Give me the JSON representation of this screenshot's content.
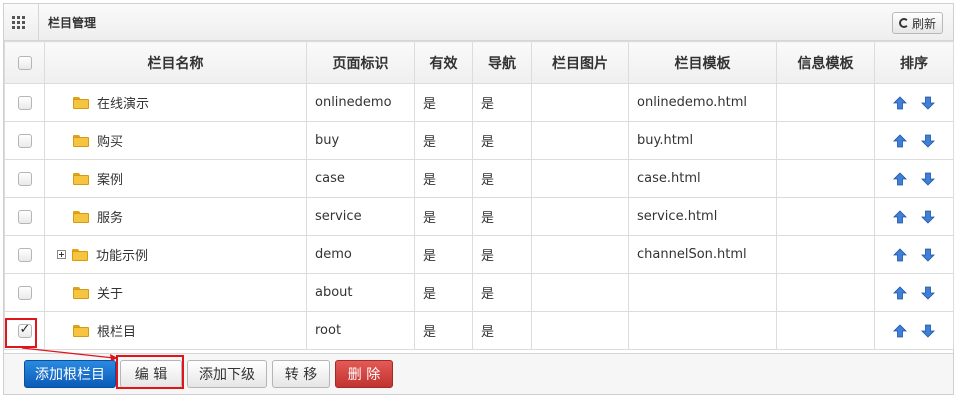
{
  "panel": {
    "title": "栏目管理",
    "refresh_label": "刷新",
    "icon": "grid-icon"
  },
  "table": {
    "columns": [
      "栏目名称",
      "页面标识",
      "有效",
      "导航",
      "栏目图片",
      "栏目模板",
      "信息模板",
      "排序"
    ],
    "rows": [
      {
        "name": "在线演示",
        "page_id": "onlinedemo",
        "valid": "是",
        "nav": "是",
        "image": "",
        "template": "onlinedemo.html",
        "info_template": "",
        "checked": false,
        "expandable": false
      },
      {
        "name": "购买",
        "page_id": "buy",
        "valid": "是",
        "nav": "是",
        "image": "",
        "template": "buy.html",
        "info_template": "",
        "checked": false,
        "expandable": false
      },
      {
        "name": "案例",
        "page_id": "case",
        "valid": "是",
        "nav": "是",
        "image": "",
        "template": "case.html",
        "info_template": "",
        "checked": false,
        "expandable": false
      },
      {
        "name": "服务",
        "page_id": "service",
        "valid": "是",
        "nav": "是",
        "image": "",
        "template": "service.html",
        "info_template": "",
        "checked": false,
        "expandable": false
      },
      {
        "name": "功能示例",
        "page_id": "demo",
        "valid": "是",
        "nav": "是",
        "image": "",
        "template": "channelSon.html",
        "info_template": "",
        "checked": false,
        "expandable": true
      },
      {
        "name": "关于",
        "page_id": "about",
        "valid": "是",
        "nav": "是",
        "image": "",
        "template": "",
        "info_template": "",
        "checked": false,
        "expandable": false
      },
      {
        "name": "根栏目",
        "page_id": "root",
        "valid": "是",
        "nav": "是",
        "image": "",
        "template": "",
        "info_template": "",
        "checked": true,
        "expandable": false
      }
    ]
  },
  "footer": {
    "add_root_label": "添加根栏目",
    "edit_label": "编 辑",
    "add_child_label": "添加下级",
    "move_label": "转 移",
    "delete_label": "删 除"
  },
  "colors": {
    "primary": "#0a5bb8",
    "danger": "#c13330",
    "highlight": "#e0141b",
    "arrow_blue": "#2d6fd1"
  }
}
